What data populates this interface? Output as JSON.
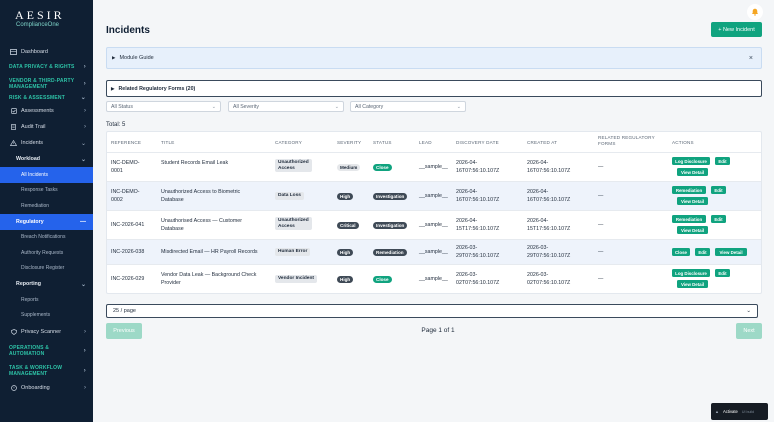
{
  "brand": {
    "name": "AESIR",
    "tagline": "ComplianceOne"
  },
  "sidebar": {
    "dashboard": "Dashboard",
    "section_privacy": "DATA PRIVACY & RIGHTS",
    "section_vendor": "VENDOR & THIRD-PARTY MANAGEMENT",
    "section_risk": "RISK & ASSESSMENT",
    "assessments": "Assessments",
    "audit_trail": "Audit Trail",
    "incidents": "Incidents",
    "workload": "Workload",
    "all_incidents": "All Incidents",
    "response_tasks": "Response Tasks",
    "remediation": "Remediation",
    "regulatory": "Regulatory",
    "breach_notifications": "Breach Notifications",
    "authority_requests": "Authority Requests",
    "disclosure_register": "Disclosure Register",
    "reporting": "Reporting",
    "reports": "Reports",
    "supplements": "Supplements",
    "privacy_scanner": "Privacy Scanner",
    "section_operations": "OPERATIONS & AUTOMATION",
    "section_task": "TASK & WORKFLOW MANAGEMENT",
    "onboarding": "Onboarding"
  },
  "header": {
    "title": "Incidents",
    "new_button": "+ New Incident"
  },
  "module_guide": {
    "label": "Module Guide",
    "close": "×"
  },
  "regulatory_forms": {
    "label": "Related Regulatory Forms (20)"
  },
  "filters": {
    "status": "All Status",
    "severity": "All Severity",
    "category": "All Category"
  },
  "total": "Total: 5",
  "table": {
    "headers": {
      "reference": "REFERENCE",
      "title": "TITLE",
      "category": "CATEGORY",
      "severity": "SEVERITY",
      "status": "STATUS",
      "lead": "LEAD",
      "discovery": "DISCOVERY DATE",
      "created": "CREATED AT",
      "forms_1": "RELATED REGULATORY",
      "forms_2": "FORMS",
      "actions": "ACTIONS"
    },
    "rows": [
      {
        "ref_1": "INC-DEMO-",
        "ref_2": "0001",
        "title_1": "Student Records Email Leak",
        "title_2": "",
        "category_1": "Unauthorized",
        "category_2": "Access",
        "severity": "Medium",
        "status": "Close",
        "lead": "__sample__",
        "discovery_1": "2026-04-",
        "discovery_2": "16T07:56:10.107Z",
        "created_1": "2026-04-",
        "created_2": "16T07:56:10.107Z",
        "forms": "—",
        "actions": [
          "Log Disclosure",
          "Edit",
          "View Detail"
        ]
      },
      {
        "ref_1": "INC-DEMO-",
        "ref_2": "0002",
        "title_1": "Unauthorized Access to Biometric",
        "title_2": "Database",
        "category_1": "Data Loss",
        "category_2": "",
        "severity": "High",
        "status": "Investigation",
        "lead": "__sample__",
        "discovery_1": "2026-04-",
        "discovery_2": "16T07:56:10.107Z",
        "created_1": "2026-04-",
        "created_2": "16T07:56:10.107Z",
        "forms": "—",
        "actions": [
          "Remediation",
          "Edit",
          "View Detail"
        ]
      },
      {
        "ref_1": "INC-2026-041",
        "ref_2": "",
        "title_1": "Unauthorised Access — Customer",
        "title_2": "Database",
        "category_1": "Unauthorized",
        "category_2": "Access",
        "severity": "Critical",
        "status": "Investigation",
        "lead": "__sample__",
        "discovery_1": "2026-04-",
        "discovery_2": "15T17:56:10.107Z",
        "created_1": "2026-04-",
        "created_2": "15T17:56:10.107Z",
        "forms": "—",
        "actions": [
          "Remediation",
          "Edit",
          "View Detail"
        ]
      },
      {
        "ref_1": "INC-2026-038",
        "ref_2": "",
        "title_1": "Misdirected Email — HR Payroll Records",
        "title_2": "",
        "category_1": "Human Error",
        "category_2": "",
        "severity": "High",
        "status": "Remediation",
        "lead": "__sample__",
        "discovery_1": "2026-03-",
        "discovery_2": "29T07:56:10.107Z",
        "created_1": "2026-03-",
        "created_2": "29T07:56:10.107Z",
        "forms": "—",
        "actions": [
          "Close",
          "Edit",
          "View Detail"
        ]
      },
      {
        "ref_1": "INC-2026-029",
        "ref_2": "",
        "title_1": "Vendor Data Leak — Background Check",
        "title_2": "Provider",
        "category_1": "Vendor Incident",
        "category_2": "",
        "severity": "High",
        "status": "Close",
        "lead": "__sample__",
        "discovery_1": "2026-03-",
        "discovery_2": "02T07:56:10.107Z",
        "created_1": "2026-03-",
        "created_2": "02T07:56:10.107Z",
        "forms": "—",
        "actions": [
          "Log Disclosure",
          "Edit",
          "View Detail"
        ]
      }
    ]
  },
  "pagination": {
    "page_size": "25 / page",
    "previous": "Previous",
    "next": "Next",
    "info": "Page 1 of 1"
  },
  "toast": {
    "label": "Activate",
    "sub": "UI build"
  },
  "colors": {
    "sidebar": "#0f1f33",
    "accent": "#10a37f",
    "active": "#2563eb",
    "section": "#2ec4a8"
  }
}
